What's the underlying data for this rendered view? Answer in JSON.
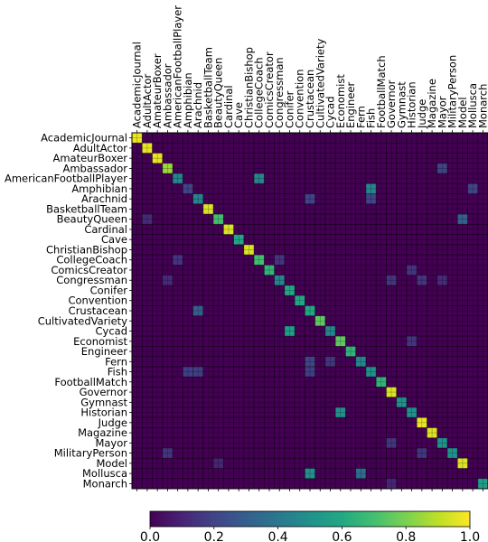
{
  "chart_data": {
    "type": "heatmap",
    "title": "",
    "xlabel": "",
    "ylabel": "",
    "colormap": "viridis",
    "vmin": 0.0,
    "vmax": 1.0,
    "colorbar": {
      "orientation": "horizontal",
      "placement": "bottom",
      "ticks": [
        "0.0",
        "0.2",
        "0.4",
        "0.6",
        "0.8",
        "1.0"
      ]
    },
    "labels": [
      "AcademicJournal",
      "AdultActor",
      "AmateurBoxer",
      "Ambassador",
      "AmericanFootballPlayer",
      "Amphibian",
      "Arachnid",
      "BasketballTeam",
      "BeautyQueen",
      "Cardinal",
      "Cave",
      "ChristianBishop",
      "CollegeCoach",
      "ComicsCreator",
      "Congressman",
      "Conifer",
      "Convention",
      "Crustacean",
      "CultivatedVariety",
      "Cycad",
      "Economist",
      "Engineer",
      "Fern",
      "Fish",
      "FootballMatch",
      "Governor",
      "Gymnast",
      "Historian",
      "Judge",
      "Magazine",
      "Mayor",
      "MilitaryPerson",
      "Model",
      "Mollusca",
      "Monarch"
    ],
    "diagonal": [
      0.97,
      0.97,
      0.97,
      0.85,
      0.45,
      0.2,
      0.45,
      0.95,
      0.7,
      0.95,
      0.6,
      0.95,
      0.7,
      0.65,
      0.45,
      0.6,
      0.6,
      0.6,
      0.75,
      0.45,
      0.75,
      0.65,
      0.45,
      0.5,
      0.65,
      0.95,
      0.5,
      0.5,
      0.97,
      0.95,
      0.5,
      0.5,
      0.95,
      0.0,
      0.55
    ],
    "off_diagonal": [
      {
        "row": 1,
        "col": 1,
        "value": 0.97
      },
      {
        "row": 3,
        "col": 30,
        "value": 0.2
      },
      {
        "row": 4,
        "col": 12,
        "value": 0.45
      },
      {
        "row": 5,
        "col": 23,
        "value": 0.45
      },
      {
        "row": 5,
        "col": 33,
        "value": 0.2
      },
      {
        "row": 6,
        "col": 17,
        "value": 0.2
      },
      {
        "row": 6,
        "col": 23,
        "value": 0.2
      },
      {
        "row": 8,
        "col": 1,
        "value": 0.12
      },
      {
        "row": 8,
        "col": 32,
        "value": 0.3
      },
      {
        "row": 12,
        "col": 4,
        "value": 0.15
      },
      {
        "row": 12,
        "col": 14,
        "value": 0.15
      },
      {
        "row": 13,
        "col": 27,
        "value": 0.15
      },
      {
        "row": 14,
        "col": 3,
        "value": 0.12
      },
      {
        "row": 14,
        "col": 25,
        "value": 0.15
      },
      {
        "row": 14,
        "col": 28,
        "value": 0.15
      },
      {
        "row": 14,
        "col": 30,
        "value": 0.12
      },
      {
        "row": 17,
        "col": 6,
        "value": 0.3
      },
      {
        "row": 19,
        "col": 15,
        "value": 0.55
      },
      {
        "row": 20,
        "col": 27,
        "value": 0.15
      },
      {
        "row": 22,
        "col": 17,
        "value": 0.2
      },
      {
        "row": 22,
        "col": 19,
        "value": 0.15
      },
      {
        "row": 23,
        "col": 5,
        "value": 0.18
      },
      {
        "row": 23,
        "col": 6,
        "value": 0.18
      },
      {
        "row": 23,
        "col": 17,
        "value": 0.18
      },
      {
        "row": 27,
        "col": 20,
        "value": 0.5
      },
      {
        "row": 30,
        "col": 25,
        "value": 0.15
      },
      {
        "row": 31,
        "col": 3,
        "value": 0.15
      },
      {
        "row": 31,
        "col": 28,
        "value": 0.15
      },
      {
        "row": 32,
        "col": 8,
        "value": 0.1
      },
      {
        "row": 33,
        "col": 17,
        "value": 0.5
      },
      {
        "row": 33,
        "col": 22,
        "value": 0.35
      },
      {
        "row": 34,
        "col": 25,
        "value": 0.1
      }
    ]
  }
}
